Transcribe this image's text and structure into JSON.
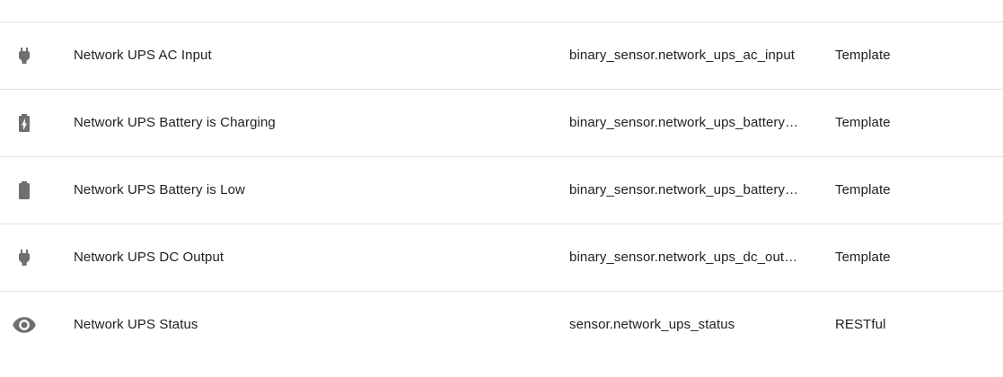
{
  "entities": [
    {
      "icon": "power-plug-icon",
      "name": "Network UPS AC Input",
      "entity_id": "binary_sensor.network_ups_ac_input",
      "integration": "Template"
    },
    {
      "icon": "battery-charging-icon",
      "name": "Network UPS Battery is Charging",
      "entity_id": "binary_sensor.network_ups_battery_is_charging",
      "integration": "Template"
    },
    {
      "icon": "battery-icon",
      "name": "Network UPS Battery is Low",
      "entity_id": "binary_sensor.network_ups_battery_is_low",
      "integration": "Template"
    },
    {
      "icon": "power-plug-icon",
      "name": "Network UPS DC Output",
      "entity_id": "binary_sensor.network_ups_dc_output",
      "integration": "Template"
    },
    {
      "icon": "eye-icon",
      "name": "Network UPS Status",
      "entity_id": "sensor.network_ups_status",
      "integration": "RESTful"
    }
  ],
  "colors": {
    "icon": "#6f6f6f",
    "text": "#212121",
    "divider": "#e0e0e0"
  }
}
